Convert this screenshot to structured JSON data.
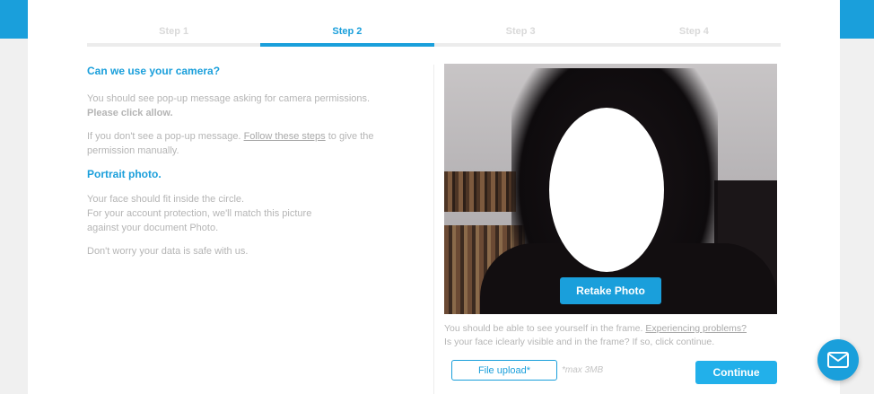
{
  "stepper": {
    "steps": [
      {
        "label": "Step 1",
        "active": false
      },
      {
        "label": "Step 2",
        "active": true
      },
      {
        "label": "Step 3",
        "active": false
      },
      {
        "label": "Step 4",
        "active": false
      }
    ]
  },
  "camera_section": {
    "heading": "Can we use your camera?",
    "para1_line1": "You should see pop-up message asking for camera permissions.",
    "para1_line2": "Please click allow.",
    "para2_prefix": "If you don't see a pop-up message.",
    "para2_link": "Follow these steps",
    "para2_suffix": "to give the permission manually."
  },
  "portrait_section": {
    "heading": "Portrait photo.",
    "para1_line1": "Your face should fit inside the circle.",
    "para1_line2": "For your account protection, we'll match this picture",
    "para1_line3": "against your document Photo.",
    "para2": "Don't worry your data is safe with us."
  },
  "preview": {
    "retake_label": "Retake Photo",
    "help_prefix": "You should be able to see yourself in the frame.",
    "help_link": "Experiencing problems?",
    "help_line2": "Is your face iclearly visible and in the frame? If so, click continue."
  },
  "actions": {
    "upload_label": "File upload*",
    "upload_note": "*max 3MB",
    "continue_label": "Continue"
  },
  "icons": {
    "fab": "mail-icon"
  },
  "colors": {
    "accent": "#1a9fdb",
    "muted_text": "#b5b5b5"
  }
}
